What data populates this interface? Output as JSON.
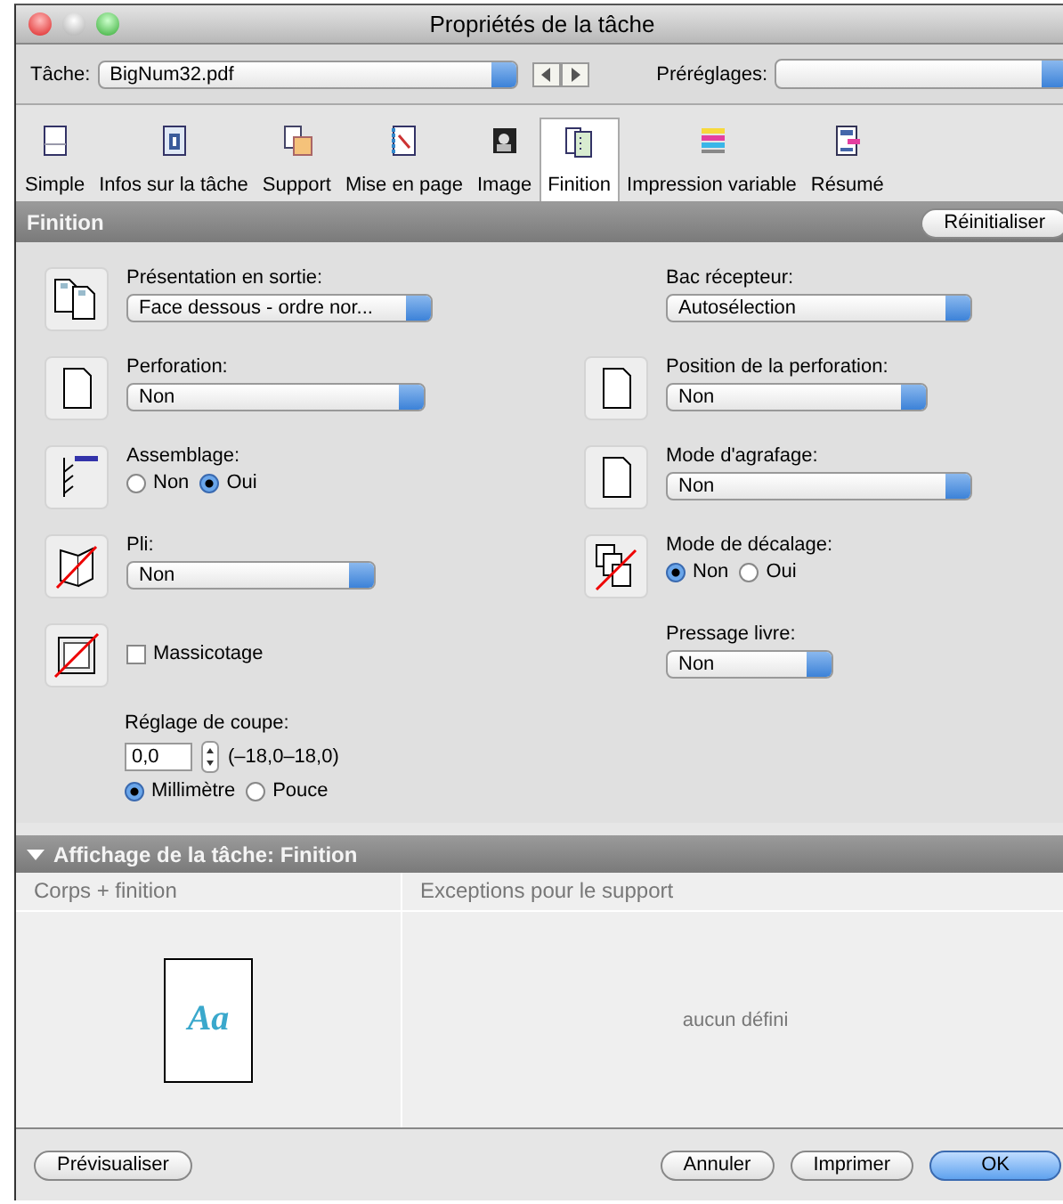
{
  "window": {
    "title": "Propriétés de la tâche"
  },
  "toolbar": {
    "task_label": "Tâche:",
    "task_value": "BigNum32.pdf",
    "presets_label": "Préréglages:"
  },
  "tabs": [
    {
      "label": "Simple",
      "selected": false
    },
    {
      "label": "Infos sur la tâche",
      "selected": false
    },
    {
      "label": "Support",
      "selected": false
    },
    {
      "label": "Mise en page",
      "selected": false
    },
    {
      "label": "Image",
      "selected": false
    },
    {
      "label": "Finition",
      "selected": true
    },
    {
      "label": "Impression variable",
      "selected": false
    },
    {
      "label": "Résumé",
      "selected": false
    }
  ],
  "section": {
    "title": "Finition",
    "reset_button": "Réinitialiser"
  },
  "rows": [
    {
      "left": {
        "kind": "popup",
        "label": "Présentation en sortie:",
        "value": "Face dessous - ordre nor..."
      },
      "right": {
        "kind": "popup",
        "label": "Bac récepteur:",
        "value": "Autosélection"
      }
    },
    {
      "left": {
        "kind": "popup",
        "label": "Perforation:",
        "value": "Non"
      },
      "right": {
        "kind": "popup",
        "label": "Position de la perforation:",
        "value": "Non"
      }
    },
    {
      "left": {
        "kind": "radio",
        "label": "Assemblage:",
        "options": [
          {
            "label": "Non",
            "selected": false
          },
          {
            "label": "Oui",
            "selected": true
          }
        ]
      },
      "right": {
        "kind": "popup",
        "label": "Mode d'agrafage:",
        "value": "Non"
      }
    },
    {
      "left": {
        "kind": "popup",
        "label": "Pli:",
        "value": "Non"
      },
      "right": {
        "kind": "radio",
        "label": "Mode de décalage:",
        "options": [
          {
            "label": "Non",
            "selected": true
          },
          {
            "label": "Oui",
            "selected": false
          }
        ]
      }
    },
    {
      "left": {
        "kind": "checkbox",
        "label": "Massicotage",
        "checked": false
      },
      "right": {
        "kind": "popup",
        "label": "Pressage livre:",
        "value": "Non"
      }
    }
  ],
  "cut_adjust": {
    "label": "Réglage de coupe:",
    "value": "0,0",
    "range": "(–18,0–18,0)",
    "units": [
      {
        "label": "Millimètre",
        "selected": true
      },
      {
        "label": "Pouce",
        "selected": false
      }
    ]
  },
  "task_display": {
    "title": "Affichage de la tâche: Finition",
    "expanded": true,
    "columns": [
      "Corps + finition",
      "Exceptions pour le support"
    ],
    "preview_text": "Aa",
    "empty_text": "aucun défini"
  },
  "buttons": {
    "preview": "Prévisualiser",
    "cancel": "Annuler",
    "print": "Imprimer",
    "ok": "OK"
  }
}
